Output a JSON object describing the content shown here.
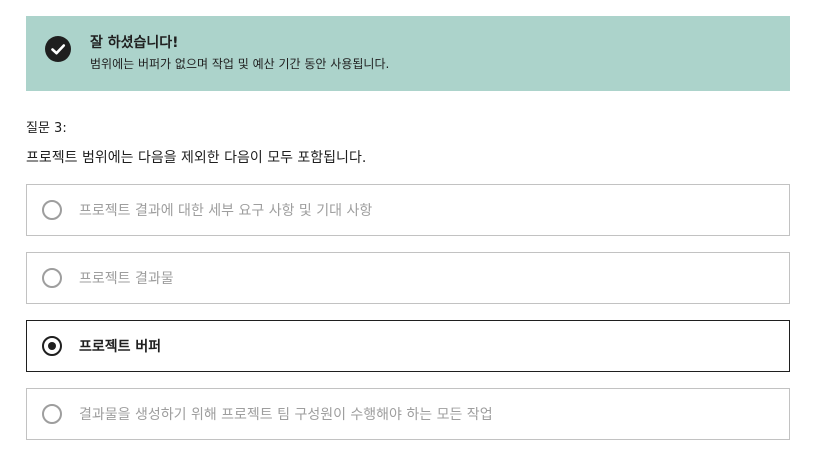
{
  "feedback": {
    "icon": "check-circle-icon",
    "title": "잘 하셨습니다!",
    "description": "범위에는 버퍼가 없으며 작업 및 예산 기간 동안 사용됩니다."
  },
  "question": {
    "label": "질문 3:",
    "text": "프로젝트 범위에는 다음을 제외한 다음이 모두 포함됩니다."
  },
  "options": [
    {
      "label": "프로젝트 결과에 대한 세부 요구 사항 및 기대 사항",
      "selected": false
    },
    {
      "label": "프로젝트 결과물",
      "selected": false
    },
    {
      "label": "프로젝트 버퍼",
      "selected": true
    },
    {
      "label": "결과물을 생성하기 위해 프로젝트 팀 구성원이 수행해야 하는 모든 작업",
      "selected": false
    }
  ],
  "colors": {
    "feedback_bg": "#acd3cb",
    "text": "#1f1f1f",
    "muted_text": "#9e9e9e",
    "border": "#c2c2c2"
  }
}
